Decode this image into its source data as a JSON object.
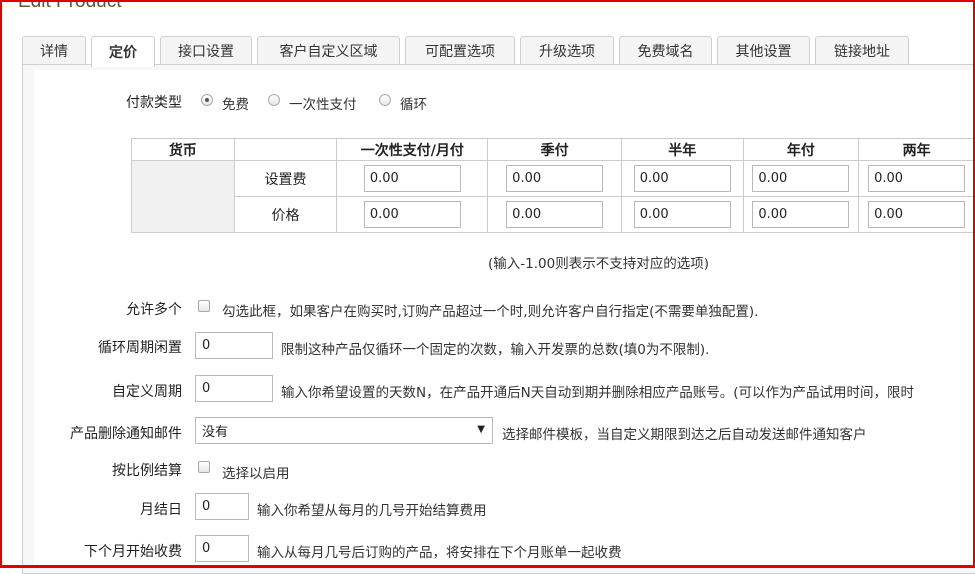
{
  "page": {
    "title": "Edit Product"
  },
  "tabs": [
    {
      "label": "详情"
    },
    {
      "label": "定价",
      "active": true
    },
    {
      "label": "接口设置"
    },
    {
      "label": "客户自定义区域"
    },
    {
      "label": "可配置选项"
    },
    {
      "label": "升级选项"
    },
    {
      "label": "免费域名"
    },
    {
      "label": "其他设置"
    },
    {
      "label": "链接地址"
    }
  ],
  "payment_type": {
    "label": "付款类型",
    "options": [
      {
        "label": "免费",
        "checked": true
      },
      {
        "label": "一次性支付",
        "checked": false
      },
      {
        "label": "循环",
        "checked": false
      }
    ]
  },
  "pricing_table": {
    "currency_header": "货币",
    "columns": [
      "一次性支付/月付",
      "季付",
      "半年",
      "年付",
      "两年"
    ],
    "rows": [
      {
        "label": "设置费",
        "values": [
          "0.00",
          "0.00",
          "0.00",
          "0.00",
          "0.00"
        ]
      },
      {
        "label": "价格",
        "values": [
          "0.00",
          "0.00",
          "0.00",
          "0.00",
          "0.00"
        ]
      }
    ],
    "hint": "(输入-1.00则表示不支持对应的选项)"
  },
  "settings": {
    "allow_multiple": {
      "label": "允许多个",
      "text": "勾选此框，如果客户在购买时,订购产品超过一个时,则允许客户自行指定(不需要单独配置)."
    },
    "recurring_cycles": {
      "label": "循环周期闲置",
      "value": "0",
      "text": "限制这种产品仅循环一个固定的次数，输入开发票的总数(填0为不限制)."
    },
    "custom_period": {
      "label": "自定义周期",
      "value": "0",
      "text": "输入你希望设置的天数N，在产品开通后N天自动到期并删除相应产品账号。(可以作为产品试用时间，限时"
    },
    "delete_notify_email": {
      "label": "产品删除通知邮件",
      "selected": "没有",
      "text": "选择邮件模板，当自定义期限到达之后自动发送邮件通知客户"
    },
    "prorata": {
      "label": "按比例结算",
      "text": "选择以启用"
    },
    "month_day": {
      "label": "月结日",
      "value": "0",
      "text": "输入你希望从每月的几号开始结算费用"
    },
    "next_month_charge": {
      "label": "下个月开始收费",
      "value": "0",
      "text": "输入从每月几号后订购的产品，将安排在下个月账单一起收费"
    }
  }
}
